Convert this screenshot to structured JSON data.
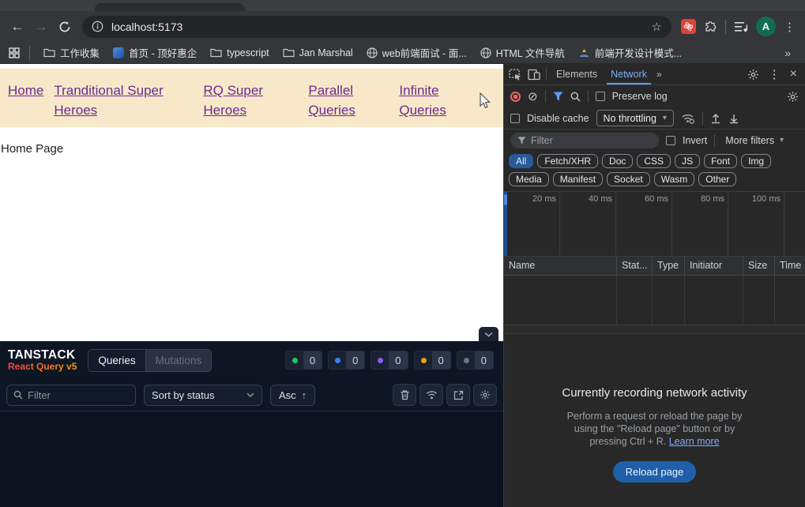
{
  "browser": {
    "url": "localhost:5173",
    "avatar_letter": "A",
    "bookmarks": [
      "工作收集",
      "首页 - 顶好惠企",
      "typescript",
      "Jan Marshal",
      "web前端面试 - 面...",
      "HTML 文件导航",
      "前端开发设计模式..."
    ],
    "bookmarks_overflow": "»",
    "back": "←",
    "forward": "→",
    "star": "☆",
    "menu": "⋮"
  },
  "page": {
    "nav_links": [
      "Home",
      "Tranditional Super Heroes",
      "RQ Super Heroes",
      "Parallel Queries",
      "Infinite Queries"
    ],
    "title": "Home Page",
    "nav_bg_color": "#f8e8ca",
    "link_color": "#6b2a8e"
  },
  "rq_devtools": {
    "logo_line1": "TANSTACK",
    "logo_line2": "React Query v5",
    "tabs": [
      "Queries",
      "Mutations"
    ],
    "badges": [
      {
        "value": "0",
        "color": "#17c964"
      },
      {
        "value": "0",
        "color": "#3b82f6"
      },
      {
        "value": "0",
        "color": "#8b5cf6"
      },
      {
        "value": "0",
        "color": "#f59e0b"
      },
      {
        "value": "0",
        "color": "#6b7280"
      }
    ],
    "filter_placeholder": "Filter",
    "sort_label": "Sort by status",
    "order_label": "Asc",
    "order_arrow": "↑",
    "collapse_icon": "⌄"
  },
  "devtools": {
    "tabs": [
      "Elements",
      "Network"
    ],
    "more_tabs": "»",
    "menu": "⋮",
    "close": "×",
    "clear_icon": "⊘",
    "preserve_log": "Preserve log",
    "disable_cache": "Disable cache",
    "throttling_value": "No throttling",
    "dropdown_arrow": "▾",
    "filter_placeholder": "Filter",
    "invert": "Invert",
    "more_filters": "More filters",
    "chips": [
      "All",
      "Fetch/XHR",
      "Doc",
      "CSS",
      "JS",
      "Font",
      "Img",
      "Media",
      "Manifest",
      "Socket",
      "Wasm",
      "Other"
    ],
    "timeline_ticks": [
      "20 ms",
      "40 ms",
      "60 ms",
      "80 ms",
      "100 ms"
    ],
    "table_columns": [
      "Name",
      "Stat...",
      "Type",
      "Initiator",
      "Size",
      "Time"
    ],
    "message": {
      "title": "Currently recording network activity",
      "line1": "Perform a request or reload the page by",
      "line2": "using the \"Reload page\" button or by",
      "line3": "pressing Ctrl + R. ",
      "learn_more": "Learn more",
      "reload_button": "Reload page"
    },
    "accent_blue": "#7cacf8",
    "record_red": "#e46962",
    "chip_active_bg": "#2a5a97"
  }
}
